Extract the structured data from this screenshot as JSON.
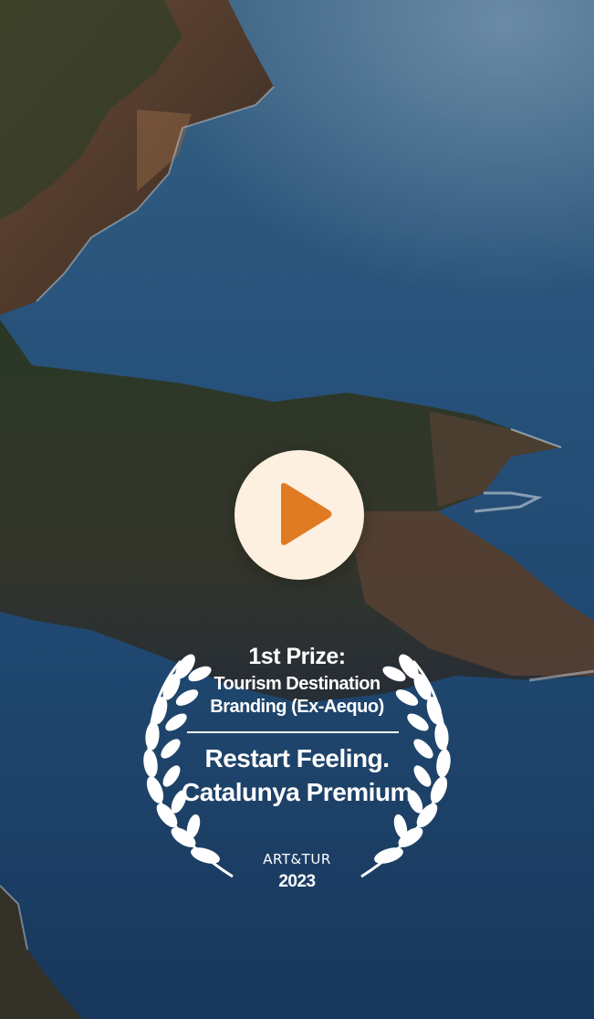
{
  "background": {
    "scene": "aerial-coastline",
    "colors": {
      "sea": "#1e3f63",
      "rocks": "#8a5d3e",
      "forest": "#2c3a22"
    }
  },
  "player": {
    "play_icon": "play-icon",
    "colors": {
      "button": "#fdf0e0",
      "icon": "#e07a23"
    }
  },
  "award": {
    "laurel_icon": "laurel-wreath-icon",
    "prize": "1st Prize:",
    "category_line1": "Tourism Destination",
    "category_line2": "Branding (Ex-Aequo)",
    "work_line1": "Restart Feeling.",
    "work_line2": "Catalunya Premium",
    "organizer": "ART&TUR",
    "year": "2023",
    "color": "#ffffff"
  }
}
